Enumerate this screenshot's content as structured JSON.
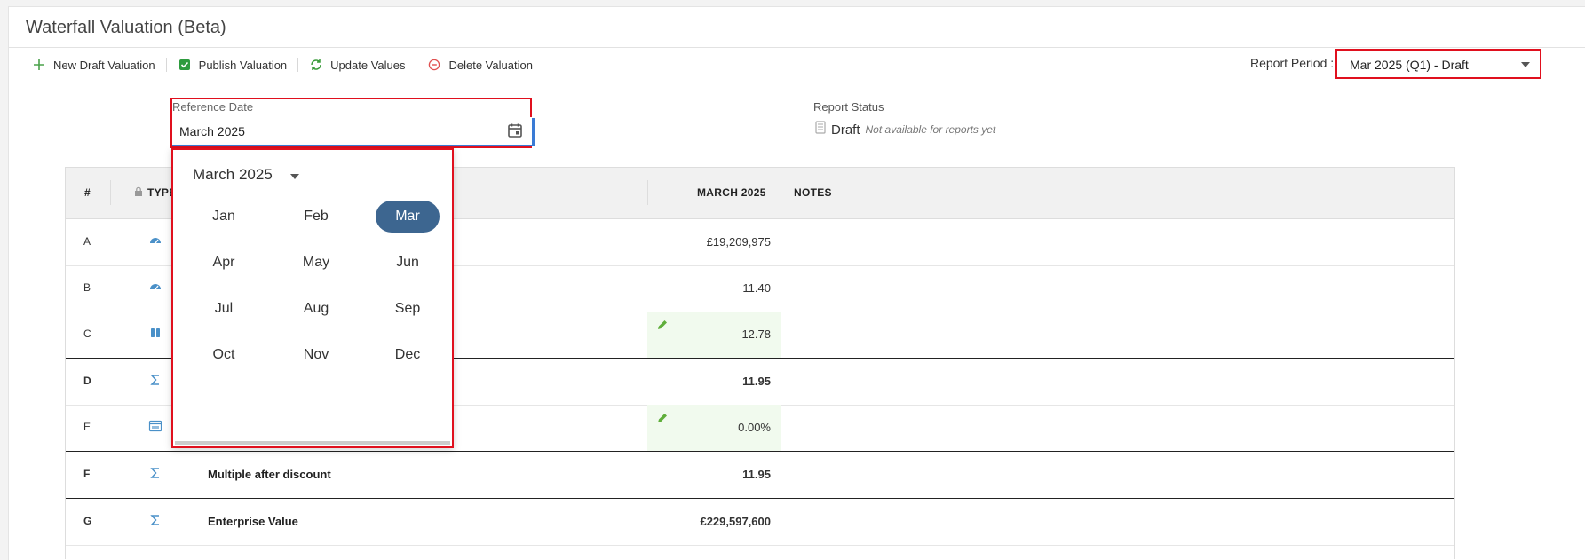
{
  "page": {
    "title": "Waterfall Valuation (Beta)"
  },
  "toolbar": {
    "new_draft": "New Draft Valuation",
    "publish": "Publish Valuation",
    "update": "Update Values",
    "delete": "Delete Valuation"
  },
  "report_period": {
    "label": "Report Period :",
    "value": "Mar 2025 (Q1) - Draft"
  },
  "reference_date": {
    "label": "Reference Date",
    "value": "March 2025"
  },
  "report_status": {
    "label": "Report Status",
    "value": "Draft",
    "note": "Not available for reports yet"
  },
  "grid": {
    "headers": {
      "id": "#",
      "type": "TYPE",
      "value": "MARCH 2025",
      "notes": "NOTES"
    },
    "rows": [
      {
        "id": "A",
        "type_icon": "gauge-icon",
        "name": "",
        "value": "£19,209,975",
        "editable": false,
        "bold": false
      },
      {
        "id": "B",
        "type_icon": "gauge-icon",
        "name": "",
        "value": "11.40",
        "editable": false,
        "bold": false
      },
      {
        "id": "C",
        "type_icon": "pause-icon",
        "name": "",
        "value": "12.78",
        "editable": true,
        "bold": false
      },
      {
        "id": "D",
        "type_icon": "sigma-icon",
        "name": "",
        "value": "11.95",
        "editable": false,
        "bold": true
      },
      {
        "id": "E",
        "type_icon": "calendar-icon",
        "name": "",
        "value": "0.00%",
        "editable": true,
        "bold": false
      },
      {
        "id": "F",
        "type_icon": "sigma-icon",
        "name": "Multiple after discount",
        "value": "11.95",
        "editable": false,
        "bold": true
      },
      {
        "id": "G",
        "type_icon": "sigma-icon",
        "name": "Enterprise Value",
        "value": "£229,597,600",
        "editable": false,
        "bold": true
      }
    ]
  },
  "month_picker": {
    "header": "March 2025",
    "selected": "Mar",
    "months": [
      "Jan",
      "Feb",
      "Mar",
      "Apr",
      "May",
      "Jun",
      "Jul",
      "Aug",
      "Sep",
      "Oct",
      "Nov",
      "Dec"
    ]
  },
  "colors": {
    "accent": "#3d6690",
    "highlight_border": "#e0101e",
    "edit_green": "#5fae3a",
    "icon_blue": "#4a90c8"
  }
}
